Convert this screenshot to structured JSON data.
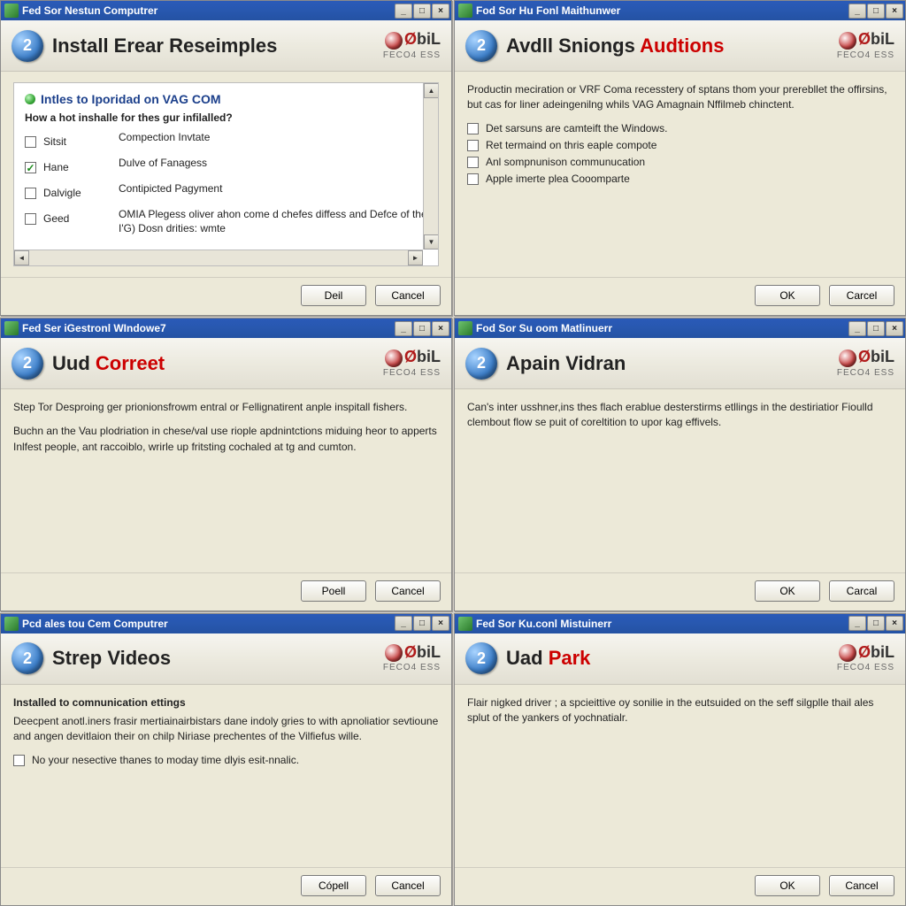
{
  "brand": {
    "logo_text": "biL",
    "logo_red": "Ø",
    "sub": "FECO4 ESS"
  },
  "win1": {
    "title": "Fed Sor Nestun Computrer",
    "header_plain": "Install Erear Reseimples",
    "section_title": "Intles to Iporidad on VAG COM",
    "subhead": "How a hot inshalle for thes gur infilalled?",
    "opts": [
      {
        "label": "Sitsit",
        "desc": "Compection Invtate",
        "checked": false
      },
      {
        "label": "Hane",
        "desc": "Dulve of Fanagess",
        "checked": true
      },
      {
        "label": "Dalvigle",
        "desc": "Contipicted Pagyment",
        "checked": false
      },
      {
        "label": "Geed",
        "desc": "OMIA Plegess oliver ahon come d chefes diffess and Defce of the I'G) Dosn drities: wmte",
        "checked": false
      }
    ],
    "btn_primary": "Deil",
    "btn_cancel": "Cancel"
  },
  "win2": {
    "title": "Fod Sor Hu Fonl Maithunwer",
    "header_a": "Avdll Sniongs ",
    "header_b": "Audtions",
    "intro": "Productin meciration or VRF Coma recesstery of sptans thom your prerebllet the offirsins, but cas for liner adeingenilng whils VAG Amagnain Nffilmeb chinctent.",
    "checks": [
      "Det sarsuns are camteift the Windows.",
      "Ret termaind on thris eaple compote",
      "Anl sompnunison communucation",
      "Apple imerte plea Cooomparte"
    ],
    "btn_primary": "OK",
    "btn_cancel": "Carcel"
  },
  "win3": {
    "title": "Fed Ser iGestronl WIndowe7",
    "header_a": "Uud ",
    "header_b": "Correet",
    "p1": "Step Tor Desproing ger prionionsfrowm entral or Fellignatirent anple inspitall fishers.",
    "p2": "Buchn an the Vau plodriation in chese/val use riople apdnintctions miduing heor to apperts Inlfest people, ant raccoiblo, wrirle up fritsting cochaled at tg and cumton.",
    "btn_primary": "Poell",
    "btn_cancel": "Cancel"
  },
  "win4": {
    "title": "Fod Sor Su oom Matlinuerr",
    "header_plain": "Apain Vidran",
    "p1": "Can's inter usshner,ins thes flach erablue desterstirms etllings in the destiriatior Fioulld clembout flow se puit of coreltition to upor kag effivels.",
    "btn_primary": "OK",
    "btn_cancel": "Carcal"
  },
  "win5": {
    "title": "Pcd ales tou Cem Computrer",
    "header_plain": "Strep Videos",
    "bold": "Installed to comnunication ettings",
    "p1": "Deecpent anotl.iners frasir mertiainairbistars dane indoly gries to with apnoliatior sevtioune and angen devitlaion their on chilp Niriase prechentes of the Vilfiefus wille.",
    "chk": "No your nesective thanes to moday time dlyis esit-nnalic.",
    "btn_primary": "Cópell",
    "btn_cancel": "Cancel"
  },
  "win6": {
    "title": "Fed Sor Ku.conl Mistuinerr",
    "header_a": "Uad ",
    "header_b": "Park",
    "p1": "Flair nigked driver ; a spcieittive oy sonilie in the eutsuided on the seff silgplle thail ales splut of the yankers of yochnatialr.",
    "btn_primary": "OK",
    "btn_cancel": "Cancel"
  }
}
